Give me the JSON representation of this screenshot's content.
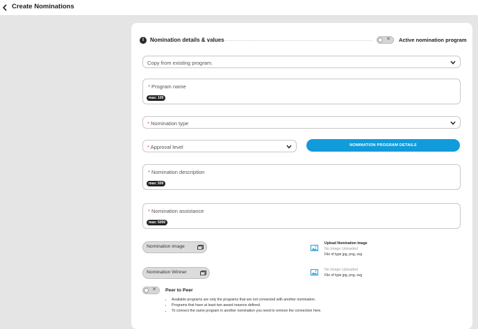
{
  "header": {
    "title": "Create Nominations"
  },
  "section": {
    "title": "Nomination details & values",
    "active_label": "Active nomination program"
  },
  "copy_select": {
    "value": "Copy from existing program."
  },
  "program_name": {
    "label": "Program name",
    "required": "*",
    "max": "max: 100"
  },
  "nomination_type": {
    "label": "Nomination type",
    "required": "*"
  },
  "approval_level": {
    "label": "Approval level",
    "required": "*"
  },
  "details_button": {
    "label": "NOMINATION PROGRAM DETAILS"
  },
  "description": {
    "label": "Nomination description",
    "required": "*",
    "max": "max: 500"
  },
  "assistance": {
    "label": "Nomination assistance",
    "required": "*",
    "max": "max: 5000"
  },
  "image_upload": {
    "button": "Nomination image",
    "title": "Upload Nomination Image",
    "status": "No Image Uploaded",
    "types": "File of type jpg, png, svg"
  },
  "winner_upload": {
    "button": "Nomination Winner",
    "status": "No Image Uploaded",
    "types": "File of type jpg, png, svg"
  },
  "peer": {
    "title": "Peer to Peer",
    "notes": [
      "Available programs are only the programs that are not connected with another nomination.",
      "Programs that have at least two award reasons defined.",
      "To connect the same program in another nomination you need to remove the connection here."
    ]
  },
  "colors": {
    "accent": "#129bdb",
    "required": "#e53935",
    "icon_blue": "#1e9ad6"
  }
}
